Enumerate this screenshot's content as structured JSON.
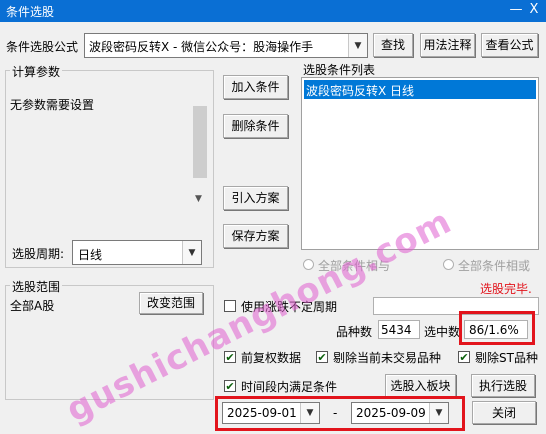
{
  "window": {
    "title": "条件选股",
    "close_glyph": "X"
  },
  "formula": {
    "label": "条件选股公式",
    "value": "波段密码反转X  -  微信公众号：股海操作手",
    "find_button": "查找",
    "usage_button": "用法注释",
    "view_button": "查看公式"
  },
  "params": {
    "group_title": "计算参数",
    "empty_text": "无参数需要设置",
    "period_label": "选股周期:",
    "period_value": "日线"
  },
  "actions": {
    "add": "加入条件",
    "remove": "删除条件",
    "import": "引入方案",
    "save": "保存方案"
  },
  "conditions": {
    "title": "选股条件列表",
    "items": [
      "波段密码反转X  日线"
    ],
    "all_and": "全部条件相与",
    "all_or": "全部条件相或"
  },
  "scope": {
    "group_title": "选股范围",
    "value": "全部A股",
    "change_button": "改变范围"
  },
  "status": {
    "done": "选股完毕."
  },
  "options": {
    "use_uncertain": "使用涨跌不定周期",
    "count_label": "品种数",
    "count_value": "5434",
    "selected_label": "选中数",
    "selected_value": "86/1.6%",
    "prev_adjust": "前复权数据",
    "exclude_untraded": "剔除当前未交易品种",
    "exclude_st": "剔除ST品种",
    "time_range": "时间段内满足条件"
  },
  "dates": {
    "from": "2025-09-01",
    "sep": "-",
    "to": "2025-09-09"
  },
  "buttons": {
    "to_block": "选股入板块",
    "run": "执行选股",
    "close": "关闭"
  },
  "watermark": "gushichanghong.com",
  "colors": {
    "title_bar": "#0a6fd4",
    "selected_row": "#0078d7",
    "status_red": "#e2141c",
    "watermark": "#e060d0"
  }
}
